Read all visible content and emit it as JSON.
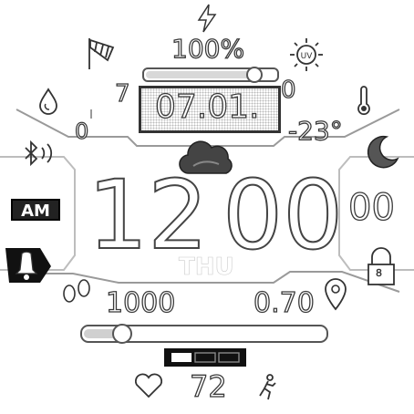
{
  "battery": {
    "percent_label": "100%",
    "level": 0.83
  },
  "date": {
    "value": "07.01.",
    "left_number": "7",
    "right_number": "0"
  },
  "weather": {
    "temperature": "-23°",
    "left_value": "0"
  },
  "time": {
    "hours": "12",
    "minutes": "00",
    "seconds": "00",
    "ampm": "AM"
  },
  "day": {
    "name": "THU"
  },
  "steps": {
    "count": "1000",
    "progress": 0.14
  },
  "distance": {
    "value": "0.70"
  },
  "lock": {
    "label": "8"
  },
  "heart_rate": {
    "value": "72"
  },
  "icons": {
    "top": "lightning-icon",
    "wind": "windsock-icon",
    "uv": "uv-sun-icon",
    "humidity": "water-drop-icon",
    "temperature": "thermometer-icon",
    "bluetooth": "bluetooth-icon",
    "moon": "moon-icon",
    "weather": "cloud-icon",
    "alarm": "bell-icon",
    "lock": "padlock-icon",
    "steps": "footprints-icon",
    "location": "location-pin-icon",
    "heart": "heart-icon",
    "activity": "running-icon"
  },
  "colors": {
    "accent": "#ffffff",
    "outline": "#3a3a3a",
    "dark": "#222222"
  }
}
